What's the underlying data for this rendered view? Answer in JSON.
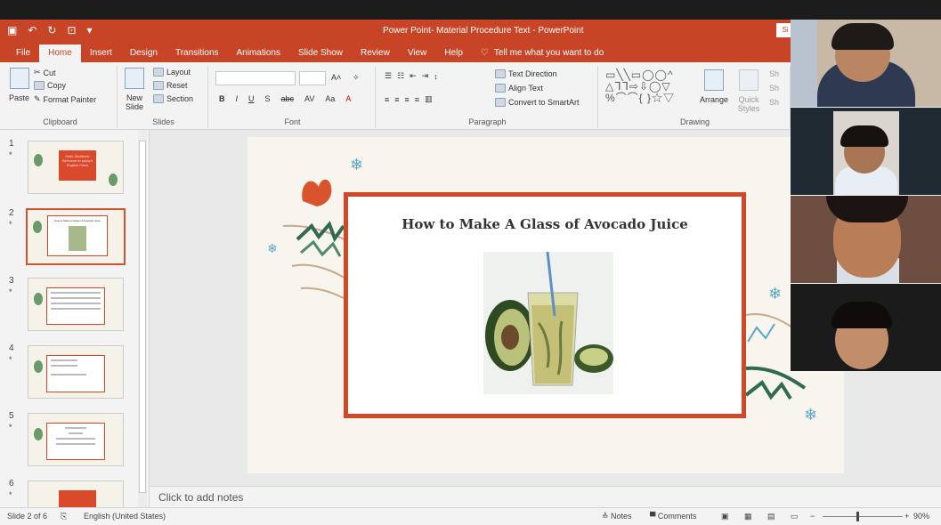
{
  "titlebar": {
    "title": "Power Point- Material Procedure Text  -  PowerPoint",
    "signin": "Si"
  },
  "tabs": [
    "File",
    "Home",
    "Insert",
    "Design",
    "Transitions",
    "Animations",
    "Slide Show",
    "Review",
    "View",
    "Help"
  ],
  "tell_me": "Tell me what you want to do",
  "ribbon": {
    "clipboard": {
      "paste": "Paste",
      "cut": "Cut",
      "copy": "Copy",
      "format_painter": "Format Painter",
      "label": "Clipboard"
    },
    "slides": {
      "new_slide": "New Slide",
      "layout": "Layout",
      "reset": "Reset",
      "section": "Section",
      "label": "Slides"
    },
    "font": {
      "label": "Font",
      "bold": "B",
      "italic": "I",
      "underline": "U",
      "shadow": "S",
      "strike": "abc",
      "spacing": "AV",
      "case": "Aa",
      "color": "A"
    },
    "paragraph": {
      "label": "Paragraph",
      "text_direction": "Text Direction",
      "align_text": "Align Text",
      "convert_smartart": "Convert to SmartArt"
    },
    "drawing": {
      "label": "Drawing",
      "arrange": "Arrange",
      "quick_styles": "Quick Styles",
      "sh1": "Sh",
      "sh2": "Sh",
      "sh3": "Sh"
    }
  },
  "thumbnails": [
    {
      "num": "1",
      "star": "*",
      "text": "Hello Students! Welcome to today's English Class"
    },
    {
      "num": "2",
      "star": "*",
      "text": "How to Make A Glass of Avocado Juice"
    },
    {
      "num": "3",
      "star": "*",
      "text": ""
    },
    {
      "num": "4",
      "star": "*",
      "text": ""
    },
    {
      "num": "5",
      "star": "*",
      "text": ""
    },
    {
      "num": "6",
      "star": "*",
      "text": ""
    }
  ],
  "slide": {
    "title": "How to Make A Glass of Avocado Juice"
  },
  "notes_placeholder": "Click to add notes",
  "status": {
    "slide_info": "Slide 2 of 6",
    "language": "English (United States)",
    "notes": "Notes",
    "comments": "Comments",
    "zoom": "90%"
  },
  "colors": {
    "accent": "#c74526",
    "frame": "#d24726"
  }
}
